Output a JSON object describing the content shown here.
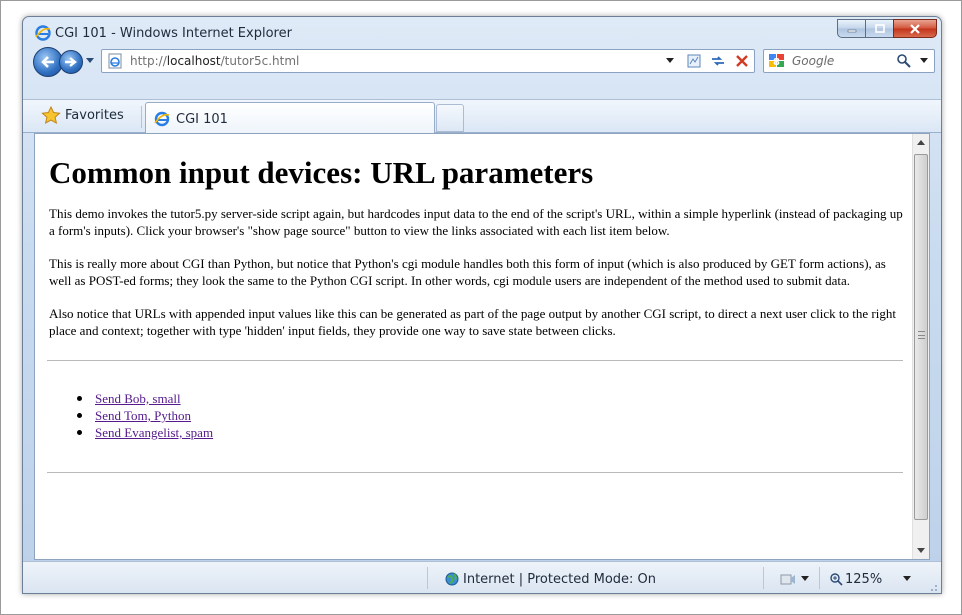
{
  "window": {
    "title": "CGI 101 - Windows Internet Explorer"
  },
  "address_bar": {
    "url_prefix": "http://",
    "url_host": "localhost",
    "url_path": "/tutor5c.html"
  },
  "search": {
    "placeholder": "Google"
  },
  "tabs": {
    "favorites_label": "Favorites",
    "active_tab_label": "CGI 101"
  },
  "page": {
    "heading": "Common input devices: URL parameters",
    "paragraphs": [
      "This demo invokes the tutor5.py server-side script again, but hardcodes input data to the end of the script's URL, within a simple hyperlink (instead of packaging up a form's inputs). Click your browser's \"show page source\" button to view the links associated with each list item below.",
      "This is really more about CGI than Python, but notice that Python's cgi module handles both this form of input (which is also produced by GET form actions), as well as POST-ed forms; they look the same to the Python CGI script. In other words, cgi module users are independent of the method used to submit data.",
      "Also notice that URLs with appended input values like this can be generated as part of the page output by another CGI script, to direct a next user click to the right place and context; together with type 'hidden' input fields, they provide one way to save state between clicks."
    ],
    "links": [
      "Send Bob, small",
      "Send Tom, Python",
      "Send Evangelist, spam"
    ]
  },
  "status_bar": {
    "zone_text": "Internet | Protected Mode: On",
    "zoom_text": "125%"
  },
  "colors": {
    "link_visited": "#551a8b",
    "chrome_blue": "#c9dbef",
    "close_red": "#c1331a"
  }
}
